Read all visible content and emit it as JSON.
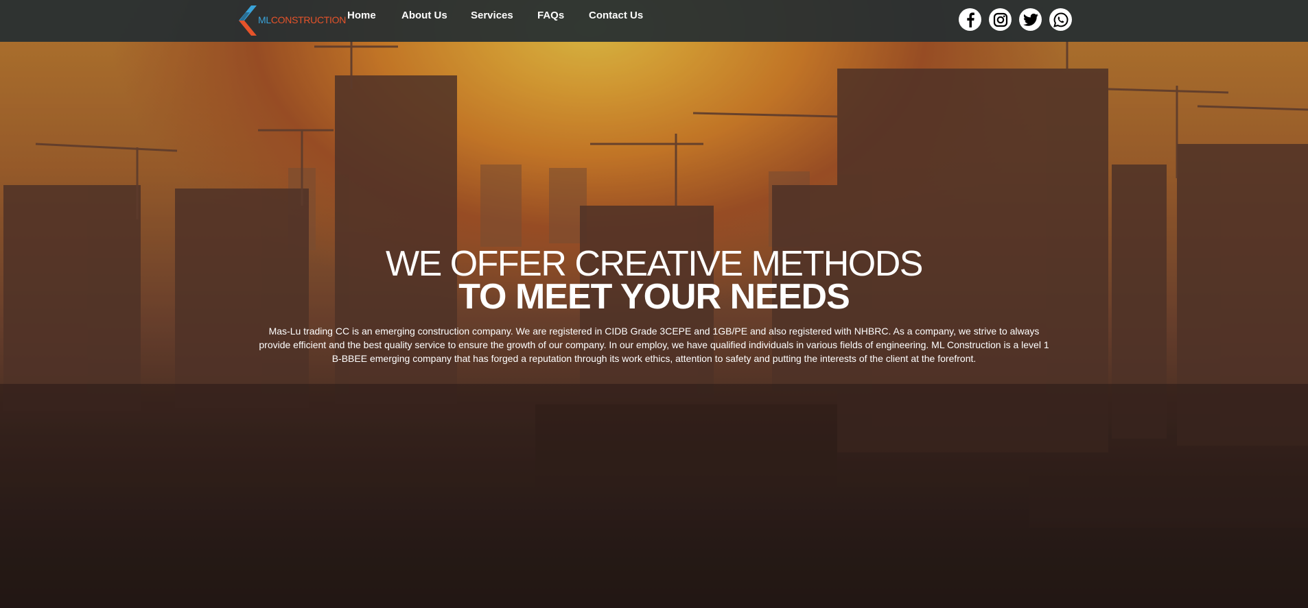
{
  "brand": {
    "name_part1": "ML",
    "name_part2": "CONSTRUCTION",
    "colors": {
      "blue": "#3aa3d9",
      "orange": "#e6532a"
    }
  },
  "nav": {
    "items": [
      {
        "label": "Home"
      },
      {
        "label": "About Us"
      },
      {
        "label": "Services"
      },
      {
        "label": "FAQs"
      },
      {
        "label": "Contact Us"
      }
    ]
  },
  "social": [
    {
      "icon": "facebook-icon"
    },
    {
      "icon": "instagram-icon"
    },
    {
      "icon": "twitter-icon"
    },
    {
      "icon": "whatsapp-icon"
    }
  ],
  "hero": {
    "headline_line1": "WE OFFER CREATIVE METHODS",
    "headline_line2": "TO MEET YOUR NEEDS",
    "description": "Mas-Lu trading CC is an emerging construction company. We are registered in CIDB Grade 3CEPE and 1GB/PE and also registered with NHBRC. As a company, we strive to always provide efficient and the best quality service to ensure the growth of our company. In our employ, we have qualified individuals in various fields of engineering. ML Construction is a level 1 B-BBEE emerging company that has forged a reputation through its work ethics, attention to safety and putting the interests of the client at the forefront."
  }
}
